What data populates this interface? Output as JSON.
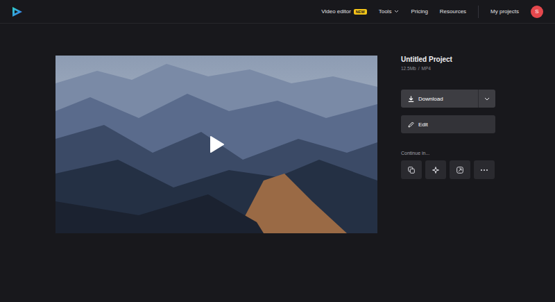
{
  "header": {
    "nav": [
      {
        "label": "Video editor",
        "kind": "badge",
        "badge": "NEW"
      },
      {
        "label": "Tools",
        "kind": "dropdown"
      },
      {
        "label": "Pricing",
        "kind": "link"
      },
      {
        "label": "Resources",
        "kind": "link"
      }
    ],
    "projects_link": "My projects",
    "avatar": "S"
  },
  "video": {
    "playing": false
  },
  "project": {
    "title": "Untitled Project",
    "size": "12.5Mb",
    "separator": "/",
    "format": "MP4"
  },
  "actions": {
    "download": "Download",
    "edit": "Edit"
  },
  "continue": {
    "label": "Continue in...",
    "apps": [
      {
        "kind": "copy"
      },
      {
        "kind": "sparkle"
      },
      {
        "kind": "share"
      },
      {
        "kind": "more"
      }
    ]
  }
}
